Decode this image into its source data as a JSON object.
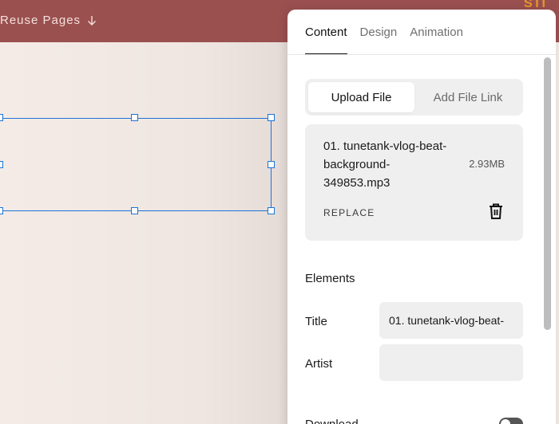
{
  "topbar": {
    "reuse_pages_label": "Reuse Pages",
    "reuse_icon": "arrow-down-icon",
    "logo_fragment": "STI"
  },
  "panel": {
    "tabs": [
      {
        "label": "Content",
        "active": true
      },
      {
        "label": "Design",
        "active": false
      },
      {
        "label": "Animation",
        "active": false
      }
    ],
    "segment": {
      "upload_label": "Upload File",
      "link_label": "Add File Link",
      "selected": "Upload File"
    },
    "file": {
      "name_line1": "01. tunetank-vlog-beat-",
      "name_line2": "background-",
      "name_line3": "349853.mp3",
      "size": "2.93MB",
      "replace_label": "REPLACE",
      "delete_icon": "trash-icon"
    },
    "elements": {
      "heading": "Elements",
      "title_label": "Title",
      "title_value": "01. tunetank-vlog-beat-",
      "artist_label": "Artist",
      "artist_value": "",
      "download_label": "Download"
    }
  },
  "colors": {
    "topbar": "#9b5050",
    "selection": "#1d73d6",
    "panel_bg": "#ffffff",
    "field_bg": "#efefef"
  }
}
